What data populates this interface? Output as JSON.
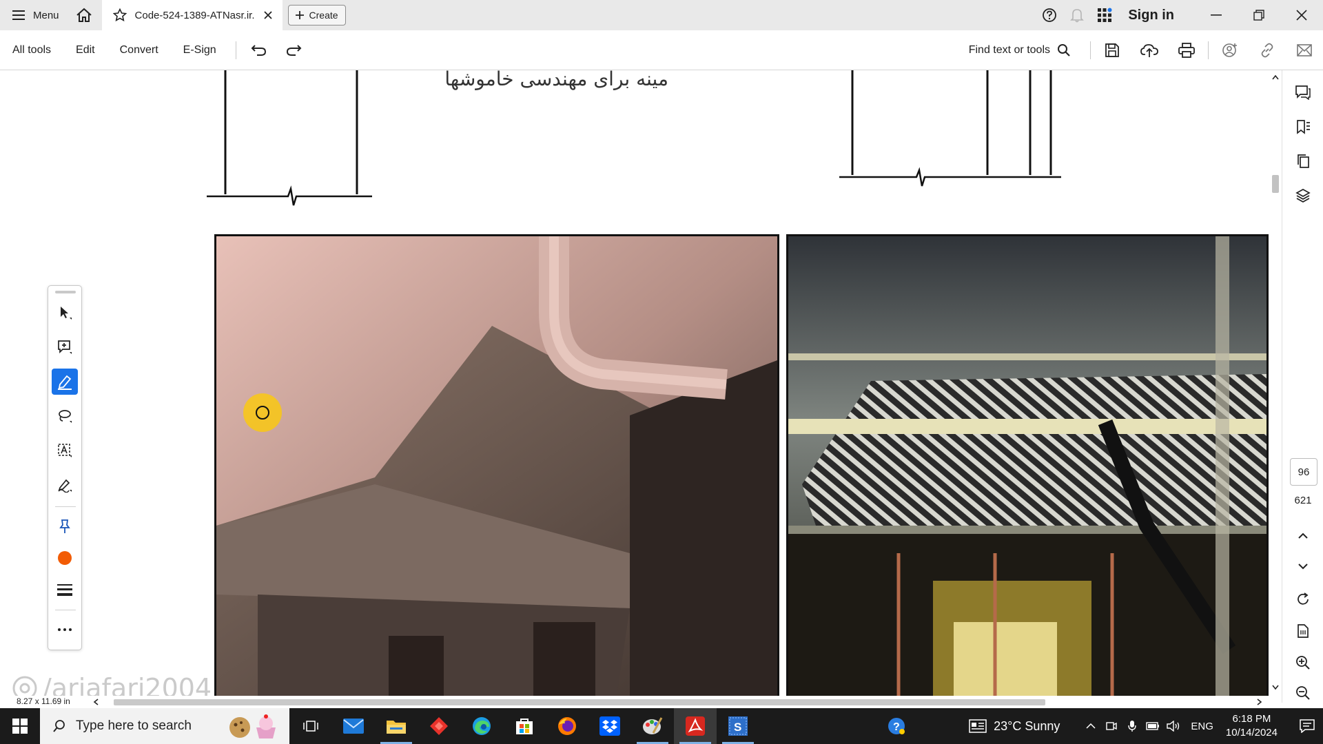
{
  "titlebar": {
    "menu_label": "Menu",
    "tab_title": "Code-524-1389-ATNasr.ir...",
    "create_label": "Create",
    "signin_label": "Sign in"
  },
  "toolbar": {
    "items": [
      "All tools",
      "Edit",
      "Convert",
      "E-Sign"
    ],
    "find_label": "Find text or tools"
  },
  "document": {
    "heading_text": "مینه برای مهندسی خاموشها",
    "watermark": "/arjafari2004"
  },
  "navigation": {
    "current_page": "96",
    "total_pages": "621"
  },
  "status": {
    "page_size": "8.27 x 11.69 in"
  },
  "taskbar": {
    "search_placeholder": "Type here to search",
    "weather": "23°C  Sunny",
    "language": "ENG",
    "time": "6:18 PM",
    "date": "10/14/2024"
  },
  "colors": {
    "accent": "#1a73e8",
    "color_swatch": "#f25c05",
    "taskbar_bg": "#1b1b1b",
    "highlight": "#ffcc00"
  }
}
